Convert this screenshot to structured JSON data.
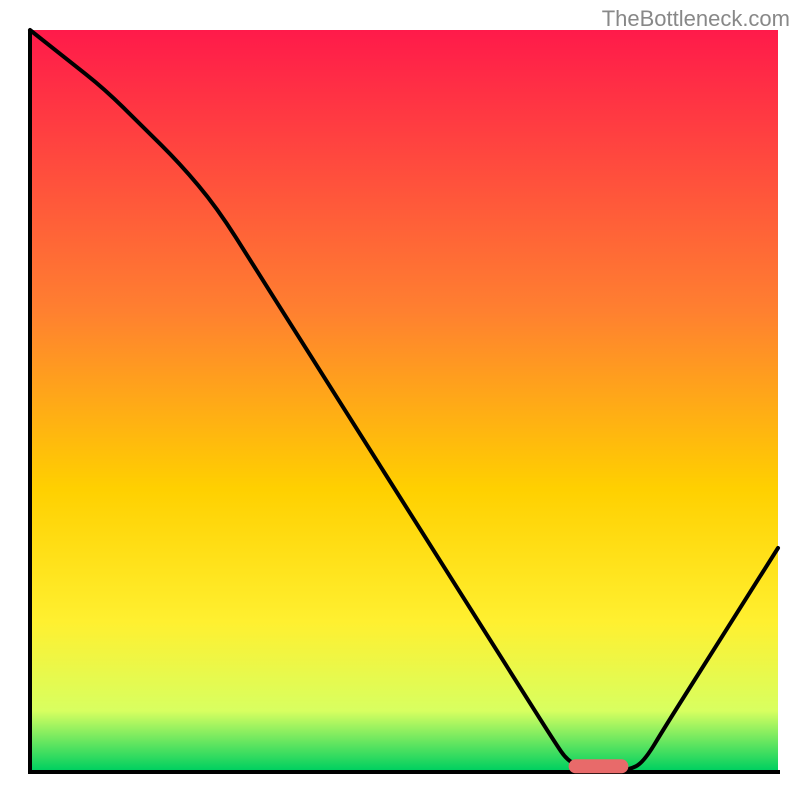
{
  "watermark": "TheBottleneck.com",
  "chart_data": {
    "type": "line",
    "title": "",
    "xlabel": "",
    "ylabel": "",
    "xlim": [
      0,
      100
    ],
    "ylim": [
      0,
      100
    ],
    "x": [
      0,
      5,
      10,
      15,
      20,
      25,
      30,
      35,
      40,
      45,
      50,
      55,
      60,
      65,
      70,
      72,
      75,
      78,
      80,
      82,
      85,
      90,
      95,
      100
    ],
    "values": [
      100,
      96,
      92,
      87,
      82,
      76,
      68,
      60,
      52,
      44,
      36,
      28,
      20,
      12,
      4,
      1,
      0,
      0,
      0,
      1,
      6,
      14,
      22,
      30
    ],
    "optimal_range_x": [
      72,
      80
    ],
    "optimal_range_y": 0.5,
    "annotations": [],
    "background_gradient": {
      "top": "#ff1a4a",
      "upper_mid": "#ff8030",
      "mid": "#ffd000",
      "lower_mid": "#fff030",
      "lower": "#d8ff60",
      "bottom": "#00d060"
    },
    "marker_color": "#e86a6a",
    "axis_color": "#000000",
    "curve_color": "#000000"
  }
}
